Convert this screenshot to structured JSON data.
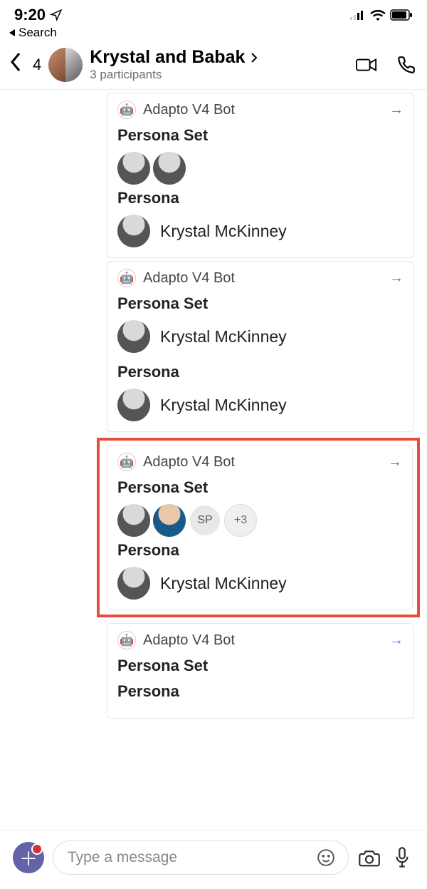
{
  "status": {
    "time": "9:20",
    "back_label": "Search"
  },
  "header": {
    "unread": "4",
    "title": "Krystal and Babak",
    "subtitle": "3 participants"
  },
  "bot_name": "Adapto V4 Bot",
  "labels": {
    "persona_set": "Persona Set",
    "persona": "Persona"
  },
  "cards": [
    {
      "set_avatars": [
        "bw",
        "bw"
      ],
      "persona_name": "Krystal McKinney"
    },
    {
      "set_avatars_named": [
        {
          "type": "bw",
          "name": "Krystal McKinney"
        }
      ],
      "persona_name": "Krystal McKinney"
    },
    {
      "highlighted": true,
      "set_avatars_mixed": [
        {
          "type": "bw"
        },
        {
          "type": "color"
        },
        {
          "type": "initials",
          "text": "SP"
        },
        {
          "type": "more",
          "text": "+3"
        }
      ],
      "persona_name": "Krystal McKinney"
    },
    {
      "sections_only": true
    }
  ],
  "compose": {
    "placeholder": "Type a message"
  }
}
